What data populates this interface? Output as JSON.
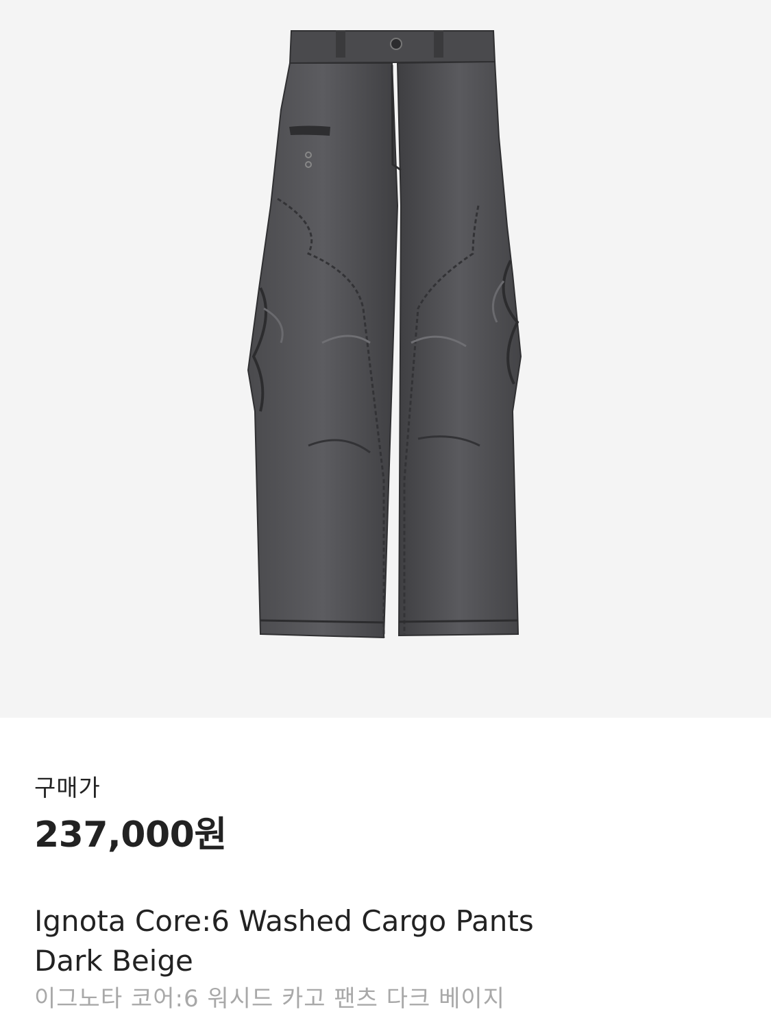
{
  "product": {
    "image_alt": "Washed cargo pants product photo",
    "price_label": "구매가",
    "price_value": "237,000원",
    "name_en_line1": "Ignota Core:6 Washed Cargo Pants",
    "name_en_line2": "Dark Beige",
    "name_ko": "이그노타 코어:6 워시드 카고 팬츠 다크 베이지"
  },
  "colors": {
    "hero_background": "#f4f4f4",
    "primary_text": "#222222",
    "secondary_text": "#a8a8a8",
    "garment_dark": "#3c3c3e",
    "garment_mid": "#56565a"
  }
}
